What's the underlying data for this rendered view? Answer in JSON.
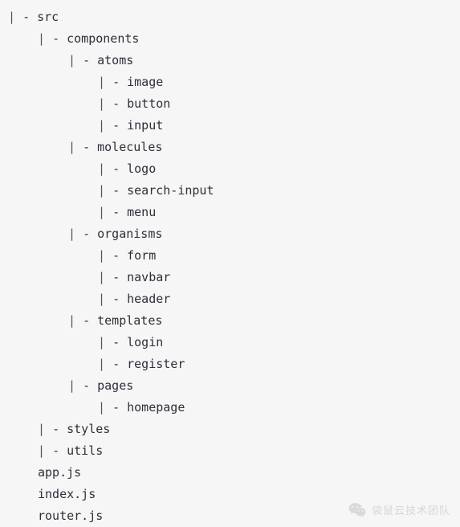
{
  "colors": {
    "background": "#f6f6f6",
    "text": "#2b3038",
    "pipe": "#4a5668",
    "watermark": "#8d8d8d"
  },
  "tree": {
    "branch_prefix": "| - ",
    "pipe_glyph": "|",
    "dash_glyph": "-",
    "lines": [
      {
        "depth": 0,
        "branch": true,
        "label": "src"
      },
      {
        "depth": 1,
        "branch": true,
        "label": "components"
      },
      {
        "depth": 2,
        "branch": true,
        "label": "atoms"
      },
      {
        "depth": 3,
        "branch": true,
        "label": "image"
      },
      {
        "depth": 3,
        "branch": true,
        "label": "button"
      },
      {
        "depth": 3,
        "branch": true,
        "label": "input"
      },
      {
        "depth": 2,
        "branch": true,
        "label": "molecules"
      },
      {
        "depth": 3,
        "branch": true,
        "label": "logo"
      },
      {
        "depth": 3,
        "branch": true,
        "label": "search-input"
      },
      {
        "depth": 3,
        "branch": true,
        "label": "menu"
      },
      {
        "depth": 2,
        "branch": true,
        "label": "organisms"
      },
      {
        "depth": 3,
        "branch": true,
        "label": "form"
      },
      {
        "depth": 3,
        "branch": true,
        "label": "navbar"
      },
      {
        "depth": 3,
        "branch": true,
        "label": "header"
      },
      {
        "depth": 2,
        "branch": true,
        "label": "templates"
      },
      {
        "depth": 3,
        "branch": true,
        "label": "login"
      },
      {
        "depth": 3,
        "branch": true,
        "label": "register"
      },
      {
        "depth": 2,
        "branch": true,
        "label": "pages"
      },
      {
        "depth": 3,
        "branch": true,
        "label": "homepage"
      },
      {
        "depth": 1,
        "branch": true,
        "label": "styles"
      },
      {
        "depth": 1,
        "branch": true,
        "label": "utils"
      },
      {
        "depth": 1,
        "branch": false,
        "label": "app.js"
      },
      {
        "depth": 1,
        "branch": false,
        "label": "index.js"
      },
      {
        "depth": 1,
        "branch": false,
        "label": "router.js"
      }
    ]
  },
  "watermark": {
    "icon": "wechat-icon",
    "text": "袋鼠云技术团队"
  }
}
